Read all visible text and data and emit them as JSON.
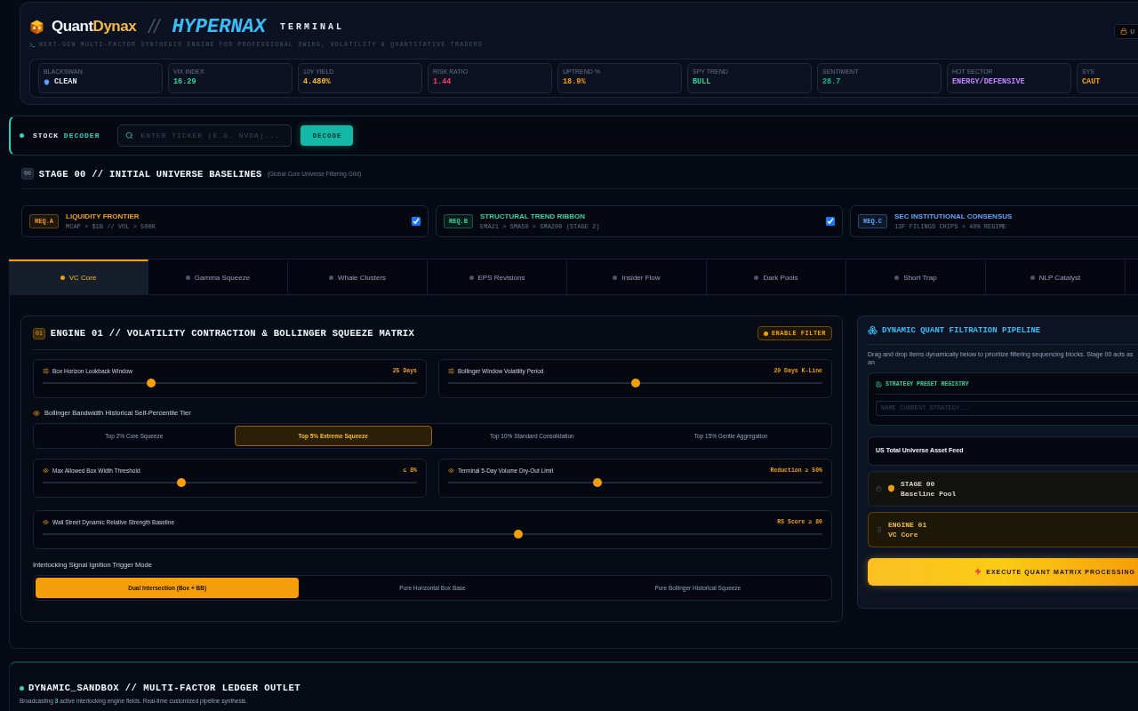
{
  "brand": {
    "name_a": "Quant",
    "name_b": "Dynax",
    "sep": "//",
    "product": "HYPERNAX",
    "suffix": "TERMINAL",
    "tagline": "NEXT-GEN MULTI-FACTOR SYNTHESIS ENGINE FOR PROFESSIONAL SWING, VOLATILITY & QUANTITATIVE TRADERS",
    "badge": "U"
  },
  "stats": [
    {
      "label": "BLACKSWAN",
      "value": "CLEAN",
      "color": "#e2e8f0",
      "icon": true
    },
    {
      "label": "VIX INDEX",
      "value": "16.29",
      "color": "#34d399"
    },
    {
      "label": "10Y YIELD",
      "value": "4.480%",
      "color": "#fbbf24"
    },
    {
      "label": "RISK RATIO",
      "value": "1.44",
      "color": "#f43f5e"
    },
    {
      "label": "UPTREND %",
      "value": "18.9%",
      "color": "#f59e0b"
    },
    {
      "label": "SPY TREND",
      "value": "BULL",
      "color": "#34d399"
    },
    {
      "label": "SENTIMENT",
      "value": "28.7",
      "color": "#10b981"
    },
    {
      "label": "HOT SECTOR",
      "value": "ENERGY/DEFENSIVE",
      "color": "#c084fc"
    },
    {
      "label": "SYS",
      "value": "CAUT",
      "color": "#f59e0b"
    }
  ],
  "decoder": {
    "label_a": "STOCK",
    "label_b": "DECODER",
    "placeholder": "ENTER TICKER (E.G. NVDA)...",
    "button": "DECODE"
  },
  "stage": {
    "badge": "00",
    "title": "STAGE 00 // INITIAL UNIVERSE BASELINES",
    "note": "(Global Core Universe Filtering Grid)",
    "requirements": [
      {
        "tag": "REQ.A",
        "title": "LIQUIDITY FRONTIER",
        "rule": "MCAP > $1B // VOL > 500K",
        "color": "#f59e0b",
        "checked": true
      },
      {
        "tag": "REQ.B",
        "title": "STRUCTURAL TREND RIBBON",
        "rule": "EMA21 > SMA50 > SMA200 (STAGE 2)",
        "color": "#34d399",
        "checked": true
      },
      {
        "tag": "REQ.C",
        "title": "SEC INSTITUTIONAL CONSENSUS",
        "rule": "13F FILINGS CHIPS > 40% REGIME",
        "color": "#60a5fa"
      }
    ]
  },
  "tabs": [
    {
      "label": "VC Core",
      "selected": true
    },
    {
      "label": "Gamma Squeeze",
      "selected": false
    },
    {
      "label": "Whale Clusters",
      "selected": false
    },
    {
      "label": "EPS Revisions",
      "selected": false
    },
    {
      "label": "Insider Flow",
      "selected": false
    },
    {
      "label": "Dark Pools",
      "selected": false
    },
    {
      "label": "Short Trap",
      "selected": false
    },
    {
      "label": "NLP Catalyst",
      "selected": false
    }
  ],
  "engine": {
    "badge": "01",
    "title": "ENGINE 01 // VOLATILITY CONTRACTION & BOLLINGER SQUEEZE MATRIX",
    "filter_button": "ENABLE FILTER",
    "sliders_top": [
      {
        "label": "Box Horizon Lookback Window",
        "reading": "25 Days",
        "level": 0.29
      },
      {
        "label": "Bollinger Window Volatility Period",
        "reading": "20 Days K-Line",
        "level": 0.5
      }
    ],
    "tier": {
      "label": "Bollinger Bandwidth Historical Self-Percentile Tier",
      "options": [
        {
          "label": "Top 2% Core Squeeze",
          "selected": false
        },
        {
          "label": "Top 5% Extreme Squeeze",
          "selected": true
        },
        {
          "label": "Top 10% Standard Consolidation",
          "selected": false
        },
        {
          "label": "Top 15% Gentle Aggregation",
          "selected": false
        }
      ]
    },
    "sliders_mid": [
      {
        "label": "Max Allowed Box Width Threshold",
        "reading": "≤ 8%",
        "level": 0.37
      },
      {
        "label": "Terminal 5-Day Volume Dry-Out Limit",
        "reading": "Reduction ≥ 50%",
        "level": 0.4
      }
    ],
    "slider_wide": {
      "label": "Wall Street Dynamic Relative Strength Baseline",
      "reading": "RS Score ≥ 80",
      "level": 0.61
    },
    "trigger": {
      "label": "Interlocking Signal Ignition Trigger Mode",
      "options": [
        {
          "label": "Dual Intersection (Box + BB)",
          "selected": true
        },
        {
          "label": "Pure Horizontal Box Base",
          "selected": false
        },
        {
          "label": "Pure Bollinger Historical Squeeze",
          "selected": false
        }
      ]
    }
  },
  "pipeline": {
    "title": "DYNAMIC QUANT FILTRATION PIPELINE",
    "description": "Drag and drop items dynamically below to prioritize filtering sequencing blocks. Stage 00 acts as an",
    "preset_title": "STRATEGY PRESET REGISTRY",
    "preset_placeholder": "NAME CURRENT STRATEGY...",
    "items": [
      {
        "kind": "feed",
        "title": "US Total Universe Asset Feed"
      },
      {
        "kind": "stage",
        "title": "STAGE 00",
        "subtitle": "Baseline Pool"
      },
      {
        "kind": "engine",
        "title": "ENGINE 01",
        "subtitle": "VC Core"
      }
    ],
    "execute": "EXECUTE QUANT MATRIX PROCESSING"
  },
  "sandbox": {
    "title": "DYNAMIC_SANDBOX // MULTI-FACTOR LEDGER OUTLET",
    "text": "Broadcasting **3** active interlocking engine fields. Real-time customized pipeline synthesis."
  }
}
